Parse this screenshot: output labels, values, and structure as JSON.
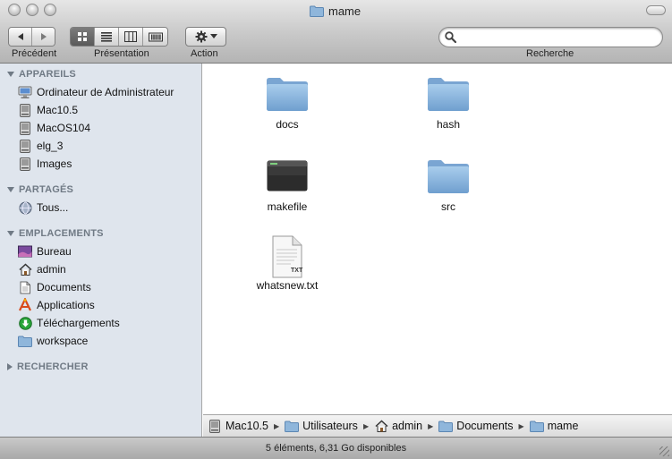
{
  "window": {
    "title": "mame"
  },
  "toolbar": {
    "back_label": "Précédent",
    "view_label": "Présentation",
    "action_label": "Action",
    "search_label": "Recherche",
    "search_value": ""
  },
  "sidebar": {
    "sections": [
      {
        "title": "APPAREILS",
        "items": [
          {
            "label": "Ordinateur de Administrateur",
            "icon": "computer-icon"
          },
          {
            "label": "Mac10.5",
            "icon": "hard-drive-icon"
          },
          {
            "label": "MacOS104",
            "icon": "hard-drive-icon"
          },
          {
            "label": "elg_3",
            "icon": "hard-drive-icon"
          },
          {
            "label": "Images",
            "icon": "hard-drive-icon"
          }
        ]
      },
      {
        "title": "PARTAGÉS",
        "items": [
          {
            "label": "Tous...",
            "icon": "network-icon"
          }
        ]
      },
      {
        "title": "EMPLACEMENTS",
        "items": [
          {
            "label": "Bureau",
            "icon": "desktop-icon"
          },
          {
            "label": "admin",
            "icon": "home-icon"
          },
          {
            "label": "Documents",
            "icon": "documents-icon"
          },
          {
            "label": "Applications",
            "icon": "applications-icon"
          },
          {
            "label": "Téléchargements",
            "icon": "downloads-icon"
          },
          {
            "label": "workspace",
            "icon": "folder-icon"
          }
        ]
      },
      {
        "title": "RECHERCHER",
        "items": []
      }
    ]
  },
  "files": [
    {
      "name": "docs",
      "icon": "folder-icon"
    },
    {
      "name": "hash",
      "icon": "folder-icon"
    },
    {
      "name": "makefile",
      "icon": "executable-icon"
    },
    {
      "name": "src",
      "icon": "folder-icon"
    },
    {
      "name": "whatsnew.txt",
      "icon": "text-file-icon",
      "badge": "TXT"
    }
  ],
  "pathbar": [
    {
      "label": "Mac10.5",
      "icon": "hard-drive-icon"
    },
    {
      "label": "Utilisateurs",
      "icon": "folder-icon"
    },
    {
      "label": "admin",
      "icon": "home-icon"
    },
    {
      "label": "Documents",
      "icon": "folder-icon"
    },
    {
      "label": "mame",
      "icon": "folder-icon"
    }
  ],
  "status": {
    "text": "5 éléments, 6,31 Go disponibles"
  }
}
